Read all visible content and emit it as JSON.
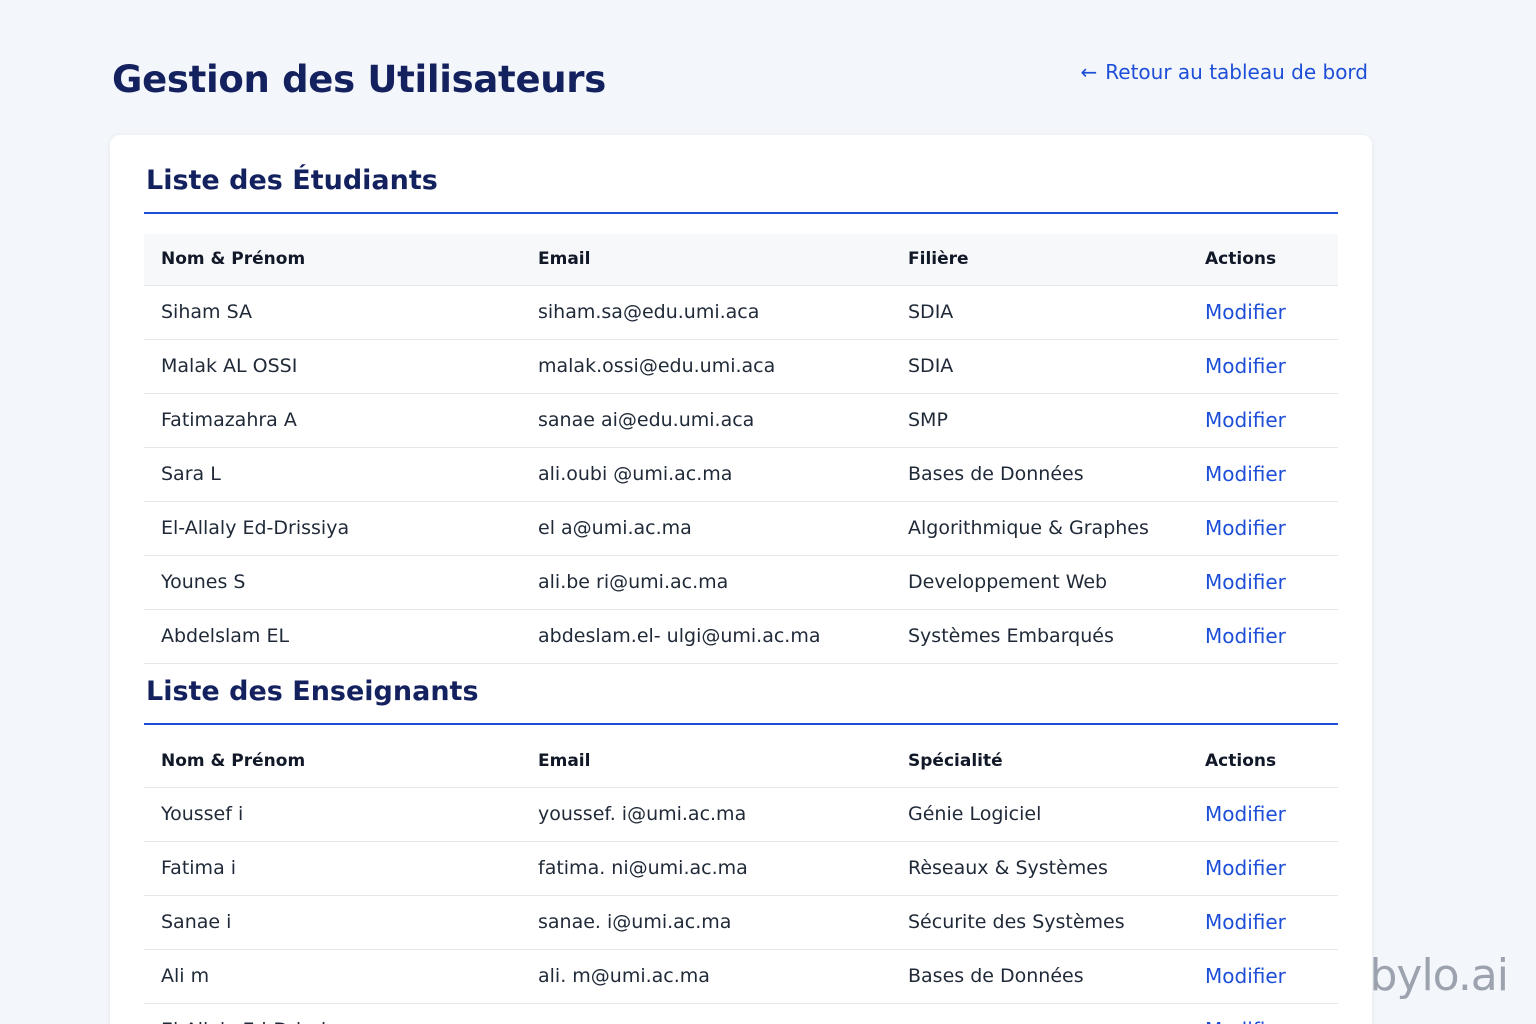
{
  "header": {
    "title": "Gestion des Utilisateurs",
    "back_arrow": "←",
    "back_label": "Retour au tableau de bord"
  },
  "students": {
    "title": "Liste des Étudiants",
    "columns": [
      "Nom & Prénom",
      "Email",
      "Filière",
      "Actions"
    ],
    "rows": [
      {
        "name": "Siham SA",
        "email": "siham.sa@edu.umi.aca",
        "field": "SDIA",
        "action": "Modifier"
      },
      {
        "name": "Malak AL OSSI",
        "email": "malak.ossi@edu.umi.aca",
        "field": "SDIA",
        "action": "Modifier"
      },
      {
        "name": "Fatimazahra A",
        "email": "sanae ai@edu.umi.aca",
        "field": "SMP",
        "action": "Modifier"
      },
      {
        "name": "Sara L",
        "email": "ali.oubi @umi.ac.ma",
        "field": "Bases de Données",
        "action": "Modifier"
      },
      {
        "name": "El-Allaly Ed-Drissiya",
        "email": "el a@umi.ac.ma",
        "field": "Algorithmique & Graphes",
        "action": "Modifier"
      },
      {
        "name": "Younes S",
        "email": "ali.be ri@umi.ac.ma",
        "field": "Developpement Web",
        "action": "Modifier"
      },
      {
        "name": "Abdelslam EL",
        "email": "abdeslam.el- ulgi@umi.ac.ma",
        "field": "Systèmes Embarqués",
        "action": "Modifier"
      }
    ]
  },
  "teachers": {
    "title": "Liste des Enseignants",
    "columns": [
      "Nom & Prénom",
      "Email",
      "Spécialité",
      "Actions"
    ],
    "rows": [
      {
        "name": "Youssef i",
        "email": "youssef. i@umi.ac.ma",
        "field": "Génie Logiciel",
        "action": "Modifier"
      },
      {
        "name": "Fatima i",
        "email": "fatima. ni@umi.ac.ma",
        "field": "Rèseaux & Systèmes",
        "action": "Modifier"
      },
      {
        "name": "Sanae i",
        "email": "sanae. i@umi.ac.ma",
        "field": "Sécurite des Systèmes",
        "action": "Modifier"
      },
      {
        "name": "Ali m",
        "email": "ali. m@umi.ac.ma",
        "field": "Bases de Données",
        "action": "Modifier"
      },
      {
        "name": "El-Allaly Ed-Drissiya",
        "email": "",
        "field": "",
        "action": "Modifier"
      }
    ]
  },
  "watermark": "bylo.ai",
  "colors": {
    "accent": "#1d4ed8",
    "title": "#14215f",
    "background": "#f3f6fa"
  }
}
